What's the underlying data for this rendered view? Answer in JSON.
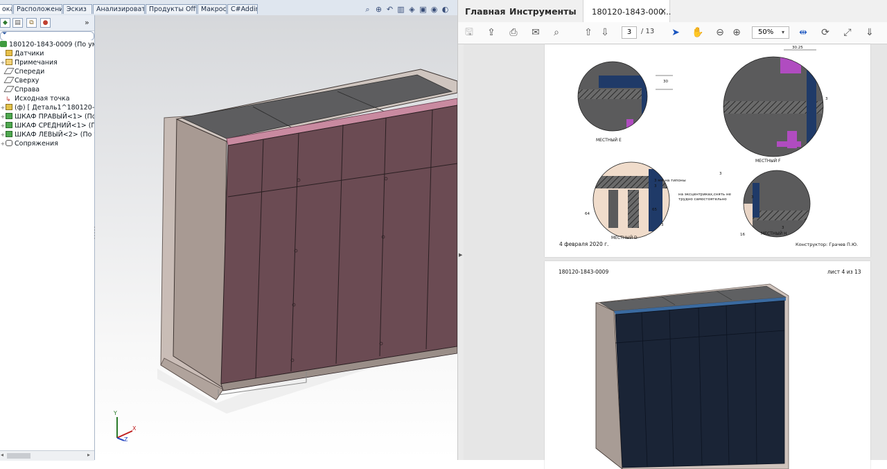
{
  "cad": {
    "tabs": [
      "ока",
      "Расположение",
      "Эскиз",
      "Анализировать",
      "Продукты Office",
      "Макрос",
      "C#Addin"
    ],
    "tree": {
      "root": "180120-1843-0009  (По умолча",
      "items": [
        {
          "label": "Датчики",
          "icon": "sensors-icon",
          "expandable": false
        },
        {
          "label": "Примечания",
          "icon": "annotations-icon",
          "expandable": true
        },
        {
          "label": "Спереди",
          "icon": "plane-icon",
          "expandable": false
        },
        {
          "label": "Сверху",
          "icon": "plane-icon",
          "expandable": false
        },
        {
          "label": "Справа",
          "icon": "plane-icon",
          "expandable": false
        },
        {
          "label": "Исходная точка",
          "icon": "origin-icon",
          "expandable": false
        },
        {
          "label": "(ф) [ Деталь1^180120-1843-",
          "icon": "part-icon",
          "expandable": true
        },
        {
          "label": "ШКАФ ПРАВЫЙ<1> (По ум",
          "icon": "assembly-icon",
          "expandable": true
        },
        {
          "label": "ШКАФ СРЕДНИЙ<1> (По у",
          "icon": "assembly-icon",
          "expandable": true
        },
        {
          "label": "ШКАФ ЛЕВЫЙ<2> (По умо",
          "icon": "assembly-icon",
          "expandable": true
        },
        {
          "label": "Сопряжения",
          "icon": "mates-icon",
          "expandable": true
        }
      ],
      "collapse_glyph": "»"
    },
    "triad": {
      "x": "X",
      "y": "Y",
      "z": "Z"
    },
    "colors": {
      "door": "#6a4a52",
      "frame": "#c9bdb6",
      "top": "#5b5b5d",
      "trim": "#c98aa0"
    }
  },
  "pdf": {
    "tabs": {
      "home": "Главная",
      "tools": "Инструменты"
    },
    "document_tab": {
      "title": "180120-1843-000...",
      "close": "×"
    },
    "toolbar": {
      "icons": [
        "save-icon",
        "upload-icon",
        "print-icon",
        "email-icon",
        "search-icon",
        "prev-page-icon",
        "next-page-icon",
        "select-cursor-icon",
        "hand-icon",
        "zoom-out-icon",
        "zoom-in-icon",
        "fit-width-icon",
        "rotate-icon",
        "fullscreen-icon",
        "download-icon"
      ],
      "page_current": "3",
      "page_total": "/  13",
      "zoom": "50%"
    },
    "page3": {
      "date": "4 февраля 2020 г.",
      "constructor": "Конструктор: Грачев П.Ю.",
      "views": [
        "МЕСТНЫЙ E",
        "МЕСТНЫЙ F",
        "МЕСТНЫЙ D",
        "МЕСТНЫЙ H"
      ],
      "dims": {
        "e_30": "30",
        "f_top": "30.25",
        "f_3": "3",
        "d_note": "3 мм на типоны",
        "d_3": "3",
        "d_64": "64",
        "d_65": "65",
        "d_3b": "3",
        "h_note1": "на эксцентриках,снять не",
        "h_note2": "трудно самостоятельно",
        "h_3a": "3",
        "h_3b": "3",
        "h_16": "16",
        "h_3c": "3"
      }
    },
    "page4": {
      "doc_number": "180120-1843-0009",
      "sheet": "лист 4 из 13"
    }
  }
}
